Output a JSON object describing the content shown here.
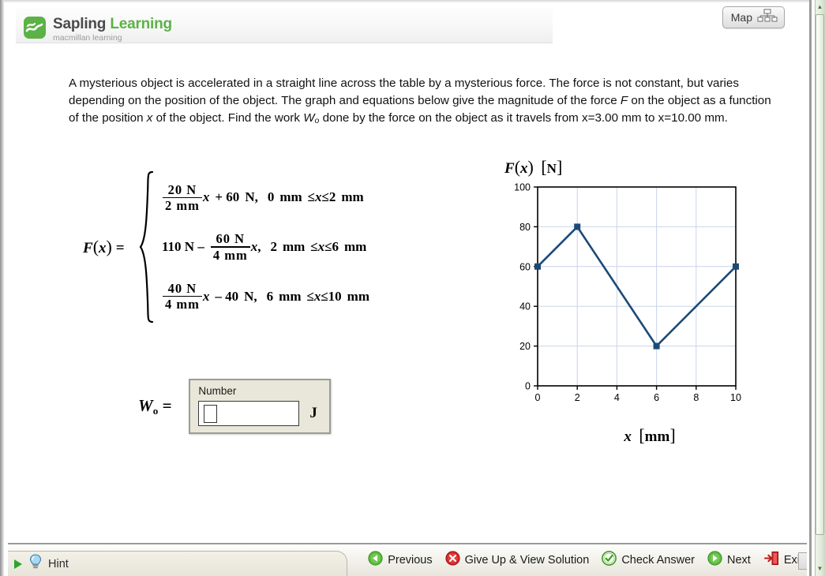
{
  "window": {
    "map_button_label": "Map",
    "map_button_icon": "site-map-icon"
  },
  "header": {
    "brand_first": "Sapling",
    "brand_second": "Learning",
    "brand_sub": "macmillan learning",
    "brand_color": "#5cb247",
    "logo_icon": "sapling-leaf-icon"
  },
  "problem": {
    "text_line_1": "A mysterious object is accelerated in a straight line across the table by a mysterious force. The force is not",
    "text_line_2": "constant, but varies depending on the position of the object. The graph and equations below give the",
    "text_part_3a": "magnitude of the force ",
    "text_part_3b": "F",
    "text_part_3c": " on the object as a function of the position ",
    "text_part_3d": "x",
    "text_part_3e": " of the object. Find the work ",
    "text_part_3f": "W",
    "text_part_3g": "o",
    "text_part_3h": " done",
    "text_line_4": "by the force on the object as it travels from x=3.00 mm to x=10.00 mm."
  },
  "equation": {
    "lhs_f": "F",
    "lhs_open": "(",
    "lhs_x": "x",
    "lhs_close": ")",
    "lhs_equals": "=",
    "cases": [
      {
        "num": "20  N",
        "den": "2  mm",
        "after_frac": "x",
        "tail": "+ 60",
        "unit": "N,",
        "domain_lo": "0",
        "domain_lo_unit": "mm",
        "le1": "≤",
        "var": "x",
        "le2": "≤",
        "domain_hi": "2",
        "domain_hi_unit": "mm",
        "lead": ""
      },
      {
        "lead": "110   N –",
        "num": "60  N",
        "den": "4  mm",
        "after_frac": "x",
        "tail": ",",
        "unit": "",
        "domain_lo": "2",
        "domain_lo_unit": "mm",
        "le1": "≤",
        "var": "x",
        "le2": "≤",
        "domain_hi": "6",
        "domain_hi_unit": "mm"
      },
      {
        "lead": "",
        "num": "40  N",
        "den": "4  mm",
        "after_frac": "x",
        "tail": "– 40",
        "unit": "N,",
        "domain_lo": "6",
        "domain_lo_unit": "mm",
        "le1": "≤",
        "var": "x",
        "le2": "≤",
        "domain_hi": "10",
        "domain_hi_unit": "mm"
      }
    ]
  },
  "answer": {
    "label_w": "W",
    "label_sub": "o",
    "label_equals": "=",
    "panel_title": "Number",
    "input_value": "",
    "input_placeholder": "",
    "unit": "J"
  },
  "chart_data": {
    "type": "line",
    "title": "",
    "xlabel": "x [mm]",
    "ylabel": "F(x) [N]",
    "ylabel_sym": "F",
    "ylabel_var": "x",
    "ylabel_unit": "N",
    "xlabel_sym": "x",
    "xlabel_unit": "mm",
    "x": [
      0,
      2,
      6,
      10
    ],
    "values": [
      60,
      80,
      20,
      60
    ],
    "xlim": [
      0,
      10
    ],
    "ylim": [
      0,
      100
    ],
    "xticks": [
      0,
      2,
      4,
      6,
      8,
      10
    ],
    "yticks": [
      0,
      20,
      40,
      60,
      80,
      100
    ],
    "xtick_labels": [
      "0",
      "2",
      "4",
      "6",
      "8",
      "10"
    ],
    "ytick_labels": [
      "0",
      "20",
      "40",
      "60",
      "80",
      "100"
    ],
    "grid": true,
    "legend": "none",
    "line_color": "#1b4a78",
    "marker": "square",
    "marker_color": "#1b4a78",
    "grid_color": "#c9d4ea",
    "axis_color": "#000000"
  },
  "toolbar": {
    "hint_label": "Hint",
    "hint_icon": "lightbulb-icon",
    "hint_arrow_icon": "play-triangle-icon",
    "items": [
      {
        "label": "Previous",
        "icon": "back-arrow-circle-icon"
      },
      {
        "label": "Give Up & View Solution",
        "icon": "red-x-circle-icon"
      },
      {
        "label": "Check Answer",
        "icon": "green-check-circle-icon"
      },
      {
        "label": "Next",
        "icon": "forward-arrow-circle-icon"
      },
      {
        "label": "Exit",
        "icon": "exit-door-icon"
      }
    ]
  }
}
